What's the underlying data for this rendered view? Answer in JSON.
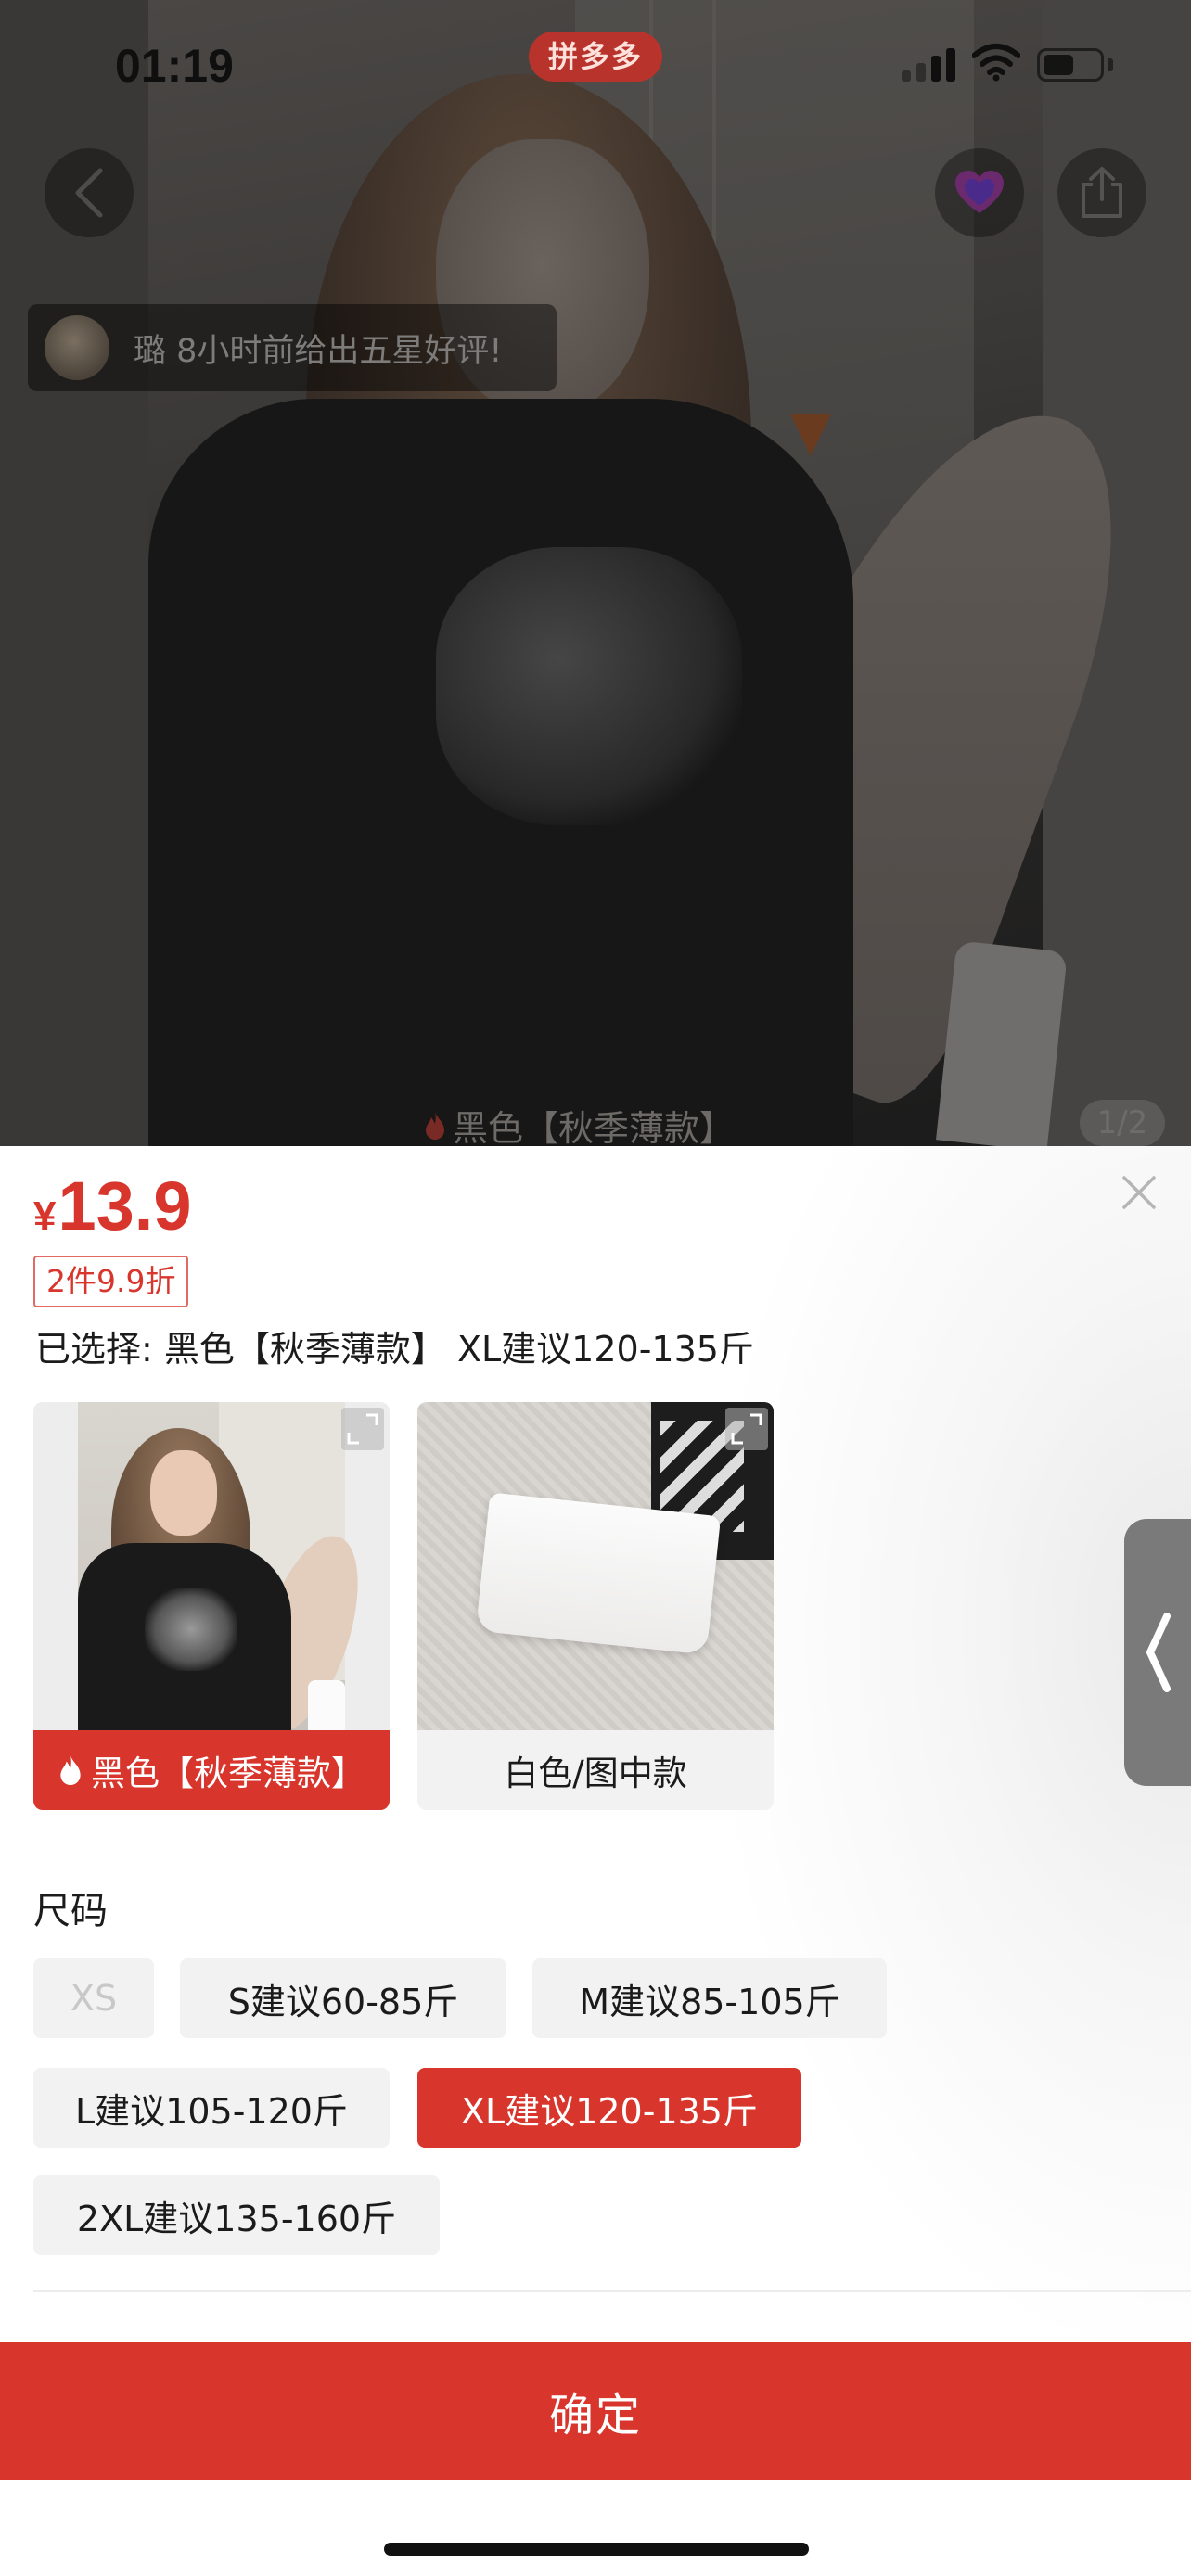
{
  "status_bar": {
    "time": "01:19",
    "app_name": "拼多多"
  },
  "photo": {
    "review_toast": "璐 8小时前给出五星好评!",
    "variant_caption": "黑色【秋季薄款】",
    "page_indicator": "1/2"
  },
  "sheet": {
    "price": {
      "currency": "¥",
      "amount": "13.9"
    },
    "discount_tag": "2件9.9折",
    "selected_summary": "已选择: 黑色【秋季薄款】 XL建议120-135斤",
    "variants": [
      {
        "label": "黑色【秋季薄款】",
        "selected": true,
        "hot": true
      },
      {
        "label": "白色/图中款",
        "selected": false,
        "hot": false
      }
    ],
    "size_title": "尺码",
    "sizes": [
      {
        "label": "XS",
        "state": "disabled"
      },
      {
        "label": "S建议60-85斤",
        "state": "normal"
      },
      {
        "label": "M建议85-105斤",
        "state": "normal"
      },
      {
        "label": "L建议105-120斤",
        "state": "normal"
      },
      {
        "label": "XL建议120-135斤",
        "state": "selected"
      },
      {
        "label": "2XL建议135-160斤",
        "state": "normal"
      }
    ],
    "confirm_label": "确定"
  },
  "colors": {
    "accent_red": "#d8362d",
    "chip_bg": "#f2f2f2",
    "disabled_text": "#c8c8c8"
  },
  "icons": [
    "back-icon",
    "favorite-icon",
    "share-icon",
    "close-icon",
    "flame-icon",
    "expand-icon",
    "collapse-handle-icon",
    "wifi-icon",
    "signal-icon",
    "battery-icon"
  ]
}
